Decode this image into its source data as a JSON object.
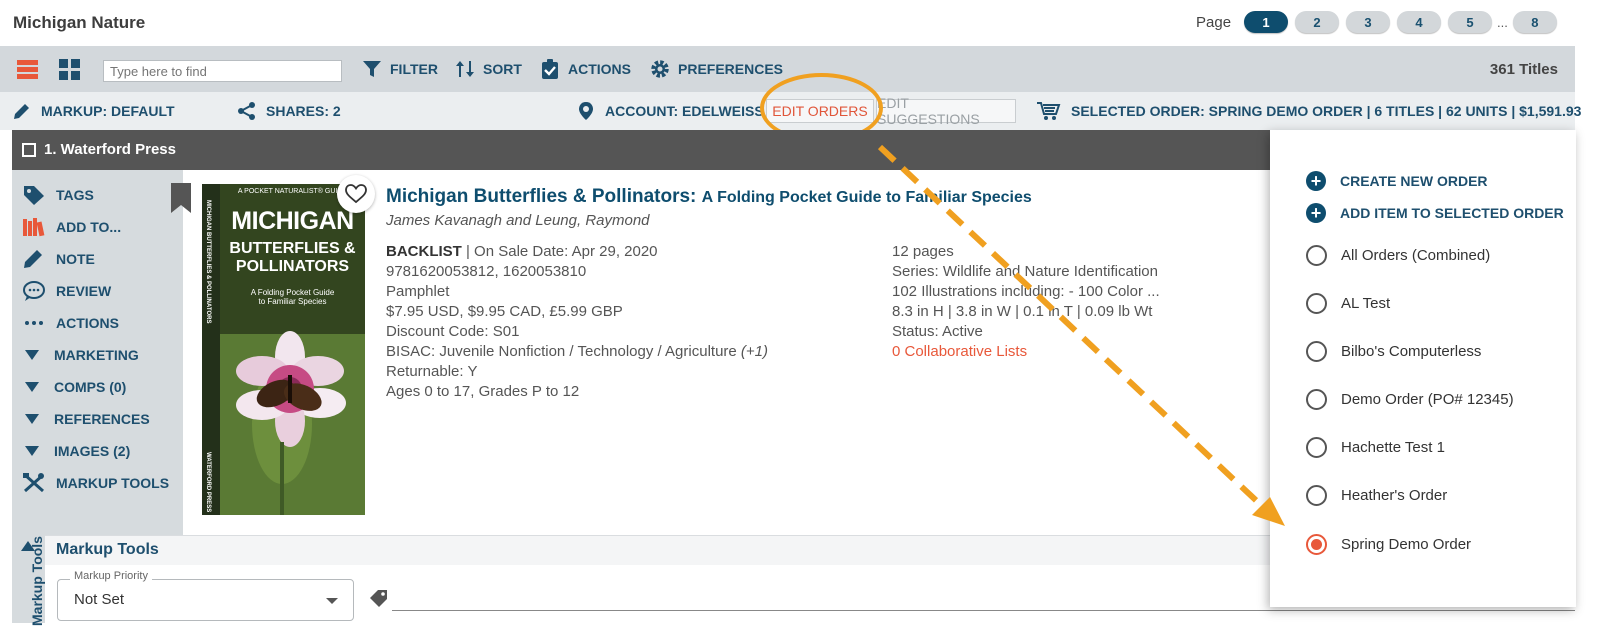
{
  "app": {
    "title": "Michigan Nature"
  },
  "pager": {
    "label": "Page",
    "pages": [
      "1",
      "2",
      "3",
      "4",
      "5"
    ],
    "ellipsis": "...",
    "last": "8",
    "current": "1"
  },
  "toolbar": {
    "search_placeholder": "Type here to find",
    "filter": "FILTER",
    "sort": "SORT",
    "actions": "ACTIONS",
    "preferences": "PREFERENCES",
    "titles_count": "361 Titles",
    "accent": "#e8583a",
    "nav_color": "#1e4f6e"
  },
  "status": {
    "markup": "MARKUP: DEFAULT",
    "shares": "SHARES: 2",
    "account": "ACCOUNT: EDELWEISS",
    "edit_orders": "EDIT ORDERS",
    "edit_suggestions": "EDIT SUGGESTIONS",
    "selected_order": "SELECTED ORDER: SPRING DEMO ORDER | 6 TITLES | 62 UNITS | $1,591.93"
  },
  "item": {
    "heading": "1. Waterford Press",
    "title": "Michigan Butterflies & Pollinators:",
    "subtitle": "A Folding Pocket Guide to Familiar Species",
    "author": "James Kavanagh and Leung, Raymond",
    "cover": {
      "top_line": "A POCKET NATURALIST® GUIDE",
      "line1": "MICHIGAN",
      "line2": "BUTTERFLIES &",
      "line3": "POLLINATORS",
      "tagline1": "A Folding Pocket Guide",
      "tagline2": "to Familiar Species",
      "spine": "MICHIGAN BUTTERFLIES & POLLINATORS",
      "publisher": "WATERFORD PRESS"
    },
    "details_left": {
      "format_label": "BACKLIST",
      "on_sale": " | On Sale Date: Apr 29, 2020",
      "isbn": "9781620053812, 1620053810",
      "binding": "Pamphlet",
      "price": "$7.95 USD, $9.95 CAD, £5.99 GBP",
      "discount": "Discount Code: S01",
      "bisac": "BISAC: Juvenile Nonfiction / Technology / Agriculture",
      "bisac_more": "(+1)",
      "returnable": "Returnable: Y",
      "ages": "Ages 0 to 17, Grades P to 12"
    },
    "details_right": {
      "pages": "12 pages",
      "series": "Series: Wildlife and Nature Identification",
      "illustrations": "102 Illustrations including: - 100 Color ...",
      "dimensions": "8.3 in H | 3.8 in W | 0.1 in T | 0.09 lb Wt",
      "status": "Status: Active",
      "collab": "0 Collaborative Lists"
    }
  },
  "sidebar": {
    "items": [
      {
        "label": "TAGS",
        "icon": "tag-icon"
      },
      {
        "label": "ADD TO...",
        "icon": "books-icon"
      },
      {
        "label": "NOTE",
        "icon": "pencil-icon"
      },
      {
        "label": "REVIEW",
        "icon": "speech-bubble-icon"
      },
      {
        "label": "ACTIONS",
        "icon": "dots-icon"
      },
      {
        "label": "MARKETING",
        "icon": "triangle-down-icon"
      },
      {
        "label": "COMPS (0)",
        "icon": "triangle-down-icon"
      },
      {
        "label": "REFERENCES",
        "icon": "triangle-down-icon"
      },
      {
        "label": "IMAGES (2)",
        "icon": "triangle-down-icon"
      },
      {
        "label": "MARKUP TOOLS",
        "icon": "tools-icon"
      }
    ]
  },
  "markup_tools": {
    "title": "Markup Tools",
    "vertical_label": "Markup Tools",
    "priority_label": "Markup Priority",
    "priority_value": "Not Set"
  },
  "order_panel": {
    "create": "CREATE NEW ORDER",
    "add_item": "ADD ITEM TO SELECTED ORDER",
    "orders": [
      "All Orders (Combined)",
      "AL Test",
      "Bilbo's Computerless",
      "Demo Order (PO# 12345)",
      "Hachette Test 1",
      "Heather's Order",
      "Spring Demo Order"
    ],
    "selected": "Spring Demo Order"
  },
  "annotation": {
    "ring_color": "#f0a020",
    "arrow_color": "#f0a020"
  }
}
